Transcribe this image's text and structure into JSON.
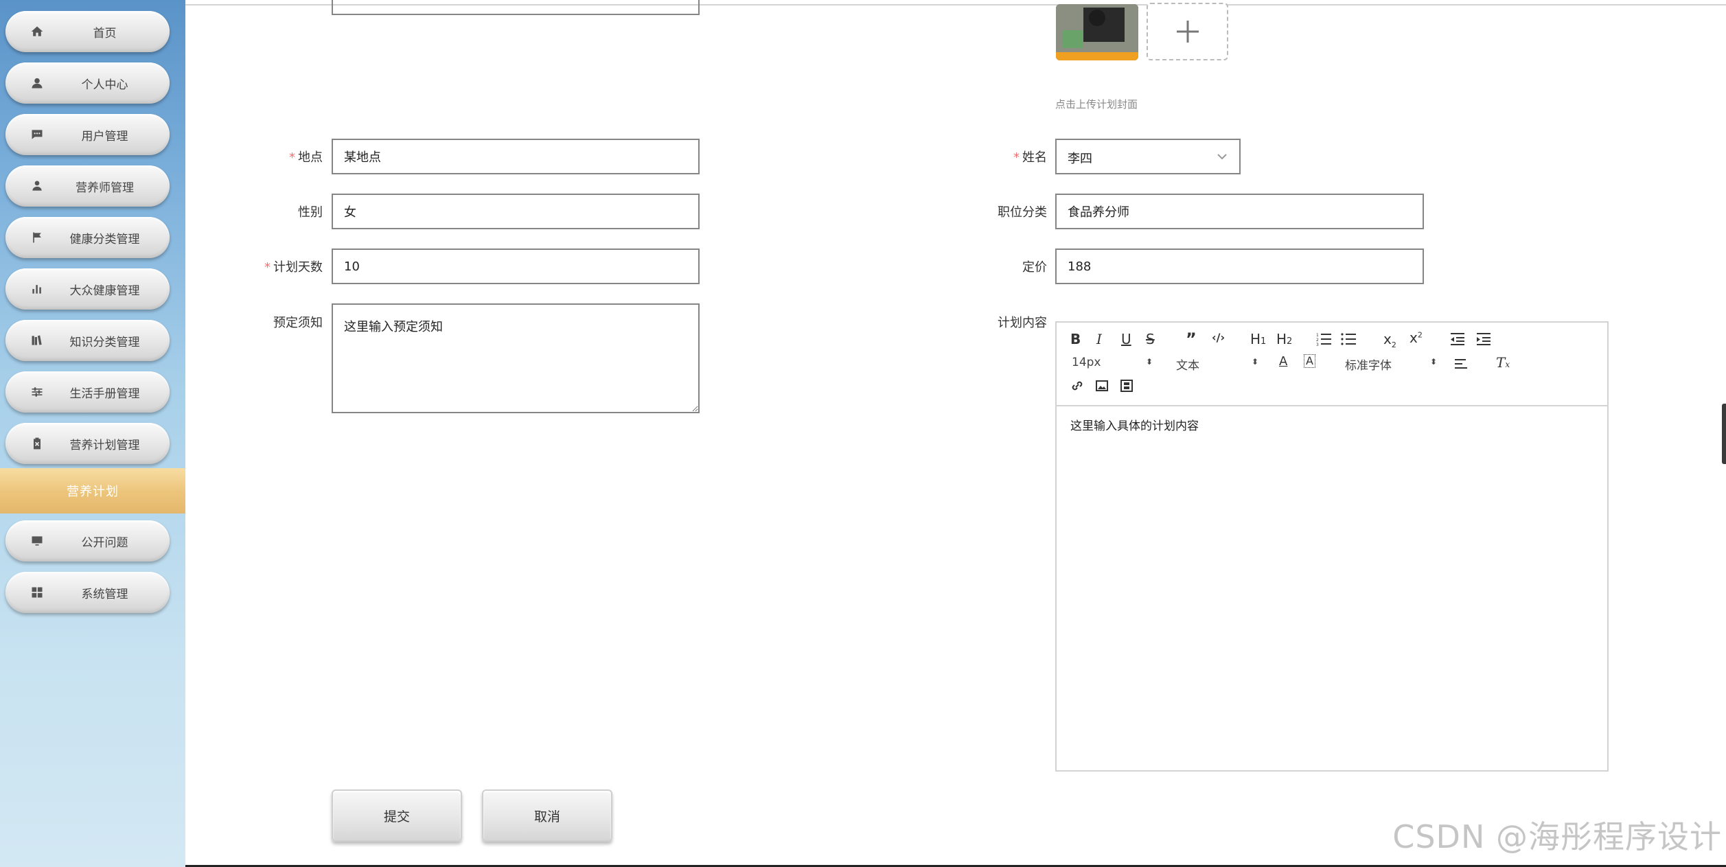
{
  "sidebar": {
    "items": [
      {
        "label": "首页",
        "icon": "home-icon"
      },
      {
        "label": "个人中心",
        "icon": "user-icon"
      },
      {
        "label": "用户管理",
        "icon": "chat-icon"
      },
      {
        "label": "营养师管理",
        "icon": "person-icon"
      },
      {
        "label": "健康分类管理",
        "icon": "flag-icon"
      },
      {
        "label": "大众健康管理",
        "icon": "bar-chart-icon"
      },
      {
        "label": "知识分类管理",
        "icon": "library-icon"
      },
      {
        "label": "生活手册管理",
        "icon": "sliders-icon"
      },
      {
        "label": "营养计划管理",
        "icon": "clipboard-icon"
      },
      {
        "label": "公开问题",
        "icon": "monitor-icon"
      },
      {
        "label": "系统管理",
        "icon": "grid-icon"
      }
    ],
    "active_label": "营养计划"
  },
  "form": {
    "upload_tip": "点击上传计划封面",
    "location": {
      "label": "地点",
      "value": "某地点"
    },
    "gender": {
      "label": "性别",
      "value": "女"
    },
    "days": {
      "label": "计划天数",
      "value": "10"
    },
    "notice": {
      "label": "预定须知",
      "value": "这里输入预定须知"
    },
    "name": {
      "label": "姓名",
      "value": "李四"
    },
    "position": {
      "label": "职位分类",
      "value": "食品养分师"
    },
    "price": {
      "label": "定价",
      "value": "188"
    },
    "content": {
      "label": "计划内容",
      "value": "这里输入具体的计划内容"
    }
  },
  "editor": {
    "font_size": "14px",
    "header_select": "文本",
    "font_family": "标准字体"
  },
  "buttons": {
    "submit": "提交",
    "cancel": "取消"
  },
  "watermark": "CSDN @海彤程序设计",
  "colors": {
    "active_menu": "#ecc47a",
    "required": "#f56c6c"
  }
}
